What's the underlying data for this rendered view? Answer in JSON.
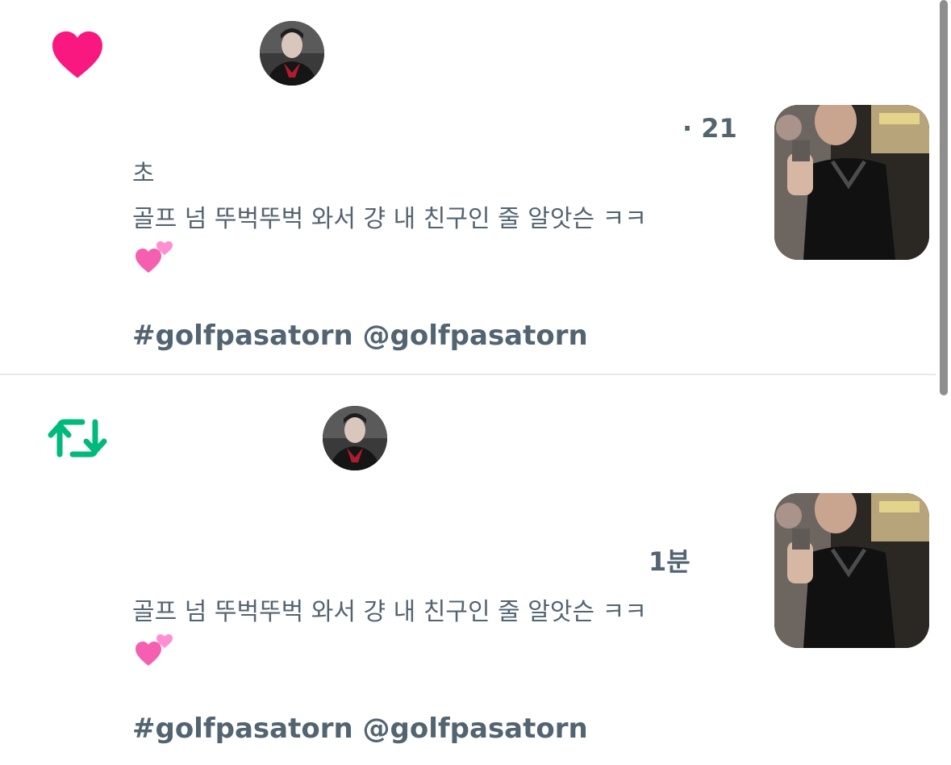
{
  "notifications": [
    {
      "type": "like",
      "icon": "heart-icon",
      "icon_color": "#f91880",
      "meta": "· 21",
      "lines": [
        "초",
        "골프 넘 뚜벅뚜벅 와서 걍 내 친구인 줄 알앗슨 ㅋㅋ"
      ],
      "emoji": "two-hearts-emoji",
      "tags": "#golfpasatorn @golfpasatorn"
    },
    {
      "type": "retweet",
      "icon": "retweet-icon",
      "icon_color": "#00ba7c",
      "meta": "1분",
      "lines": [
        "골프 넘 뚜벅뚜벅 와서 걍 내 친구인 줄 알앗슨 ㅋㅋ"
      ],
      "emoji": "two-hearts-emoji",
      "tags": "#golfpasatorn @golfpasatorn"
    }
  ],
  "colors": {
    "text": "#536471",
    "divider": "#e7e9ea",
    "like": "#f91880",
    "retweet": "#00ba7c"
  }
}
